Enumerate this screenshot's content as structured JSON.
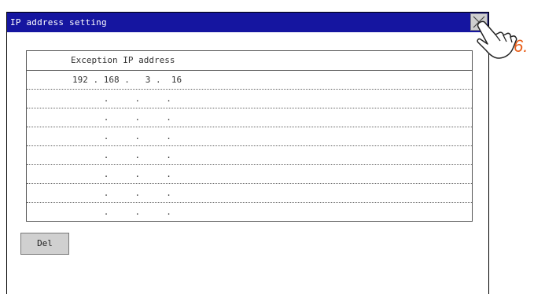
{
  "window": {
    "title": "IP address setting"
  },
  "table": {
    "header": "Exception IP address",
    "rows": [
      "192 . 168 .   3 .  16",
      "      .     .     .",
      "      .     .     .",
      "      .     .     .",
      "      .     .     .",
      "      .     .     .",
      "      .     .     .",
      "      .     .     ."
    ]
  },
  "buttons": {
    "delete_label": "Del"
  },
  "annotation": {
    "step": "6."
  },
  "colors": {
    "titlebar": "#1515a0",
    "annotation": "#e8601c"
  },
  "icons": {
    "close": "close-icon",
    "hand": "pointing-hand-icon"
  }
}
